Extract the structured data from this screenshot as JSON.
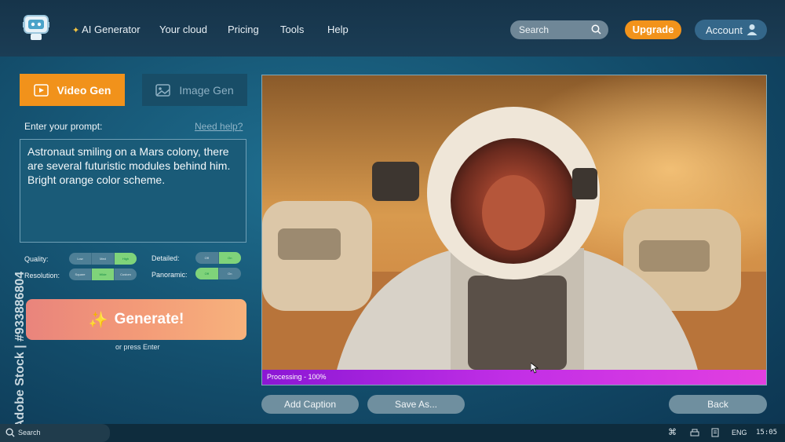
{
  "nav": {
    "items": [
      "AI Generator",
      "Your cloud",
      "Pricing",
      "Tools",
      "Help"
    ],
    "search_placeholder": "Search",
    "upgrade_label": "Upgrade",
    "account_label": "Account"
  },
  "tabs": {
    "video": "Video Gen",
    "image": "Image Gen"
  },
  "prompt": {
    "label": "Enter your prompt:",
    "help_link": "Need help?",
    "text": "Astronaut smiling on a Mars colony, there are several futuristic modules behind him. Bright orange color scheme."
  },
  "options": {
    "quality": {
      "label": "Quality:",
      "values": [
        "Low",
        "Med",
        "High"
      ],
      "selected": "High"
    },
    "resolution": {
      "label": "Resolution:",
      "values": [
        "Square",
        "Wide",
        "Custom"
      ],
      "selected": "Wide"
    },
    "detailed": {
      "label": "Detailed:",
      "values": [
        "Off",
        "On"
      ],
      "selected": "On"
    },
    "panoramic": {
      "label": "Panoramic:",
      "values": [
        "Off",
        "On"
      ],
      "selected": "Off"
    }
  },
  "generate": {
    "label": "Generate!",
    "hint": "or press Enter"
  },
  "preview": {
    "progress_text": "Processing - 100%",
    "progress_value": 1.0
  },
  "actions": {
    "add_caption": "Add Caption",
    "save_as": "Save As...",
    "back": "Back"
  },
  "taskbar": {
    "search_label": "Search",
    "language": "ENG",
    "time": "15:05"
  },
  "watermark": {
    "text": "Adobe Stock | #933886804"
  },
  "colors": {
    "accent_orange": "#f1921b",
    "progress_purple": "#c22fe6",
    "toggle_on": "#7fd37a"
  }
}
